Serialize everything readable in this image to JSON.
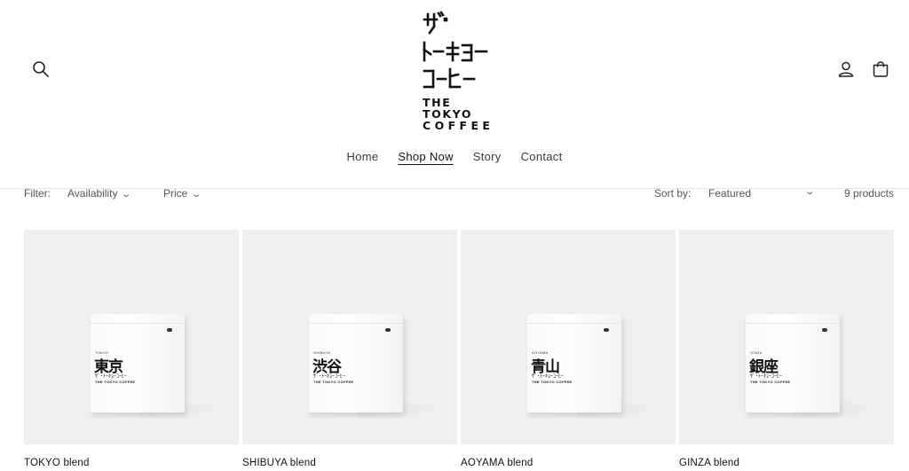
{
  "header": {
    "logo_en_line1": "THE TOKYO",
    "logo_en_line2": "COFFEE",
    "search_icon": "search-icon",
    "account_icon": "user-icon",
    "cart_icon": "shopping-bag-icon"
  },
  "nav": {
    "items": [
      {
        "label": "Home"
      },
      {
        "label": "Shop Now"
      },
      {
        "label": "Story"
      },
      {
        "label": "Contact"
      }
    ],
    "active": "Shop Now"
  },
  "filters": {
    "label": "Filter:",
    "availability": "Availability",
    "price": "Price",
    "sort_label": "Sort by:",
    "sort_value": "Featured",
    "count": "9 products"
  },
  "products": [
    {
      "title": "TOKYO blend",
      "kanji": "東京",
      "romaji": "TOKYO"
    },
    {
      "title": "SHIBUYA blend",
      "kanji": "渋谷",
      "romaji": "SHIBUYA"
    },
    {
      "title": "AOYAMA blend",
      "kanji": "青山",
      "romaji": "AOYAMA"
    },
    {
      "title": "GINZA blend",
      "kanji": "銀座",
      "romaji": "GINZA"
    }
  ],
  "pouch_text": {
    "katakana": "ｻﾞ･ﾄｰｷｮｰｺｰﾋｰ",
    "english": "THE TOKYO COFFEE"
  }
}
